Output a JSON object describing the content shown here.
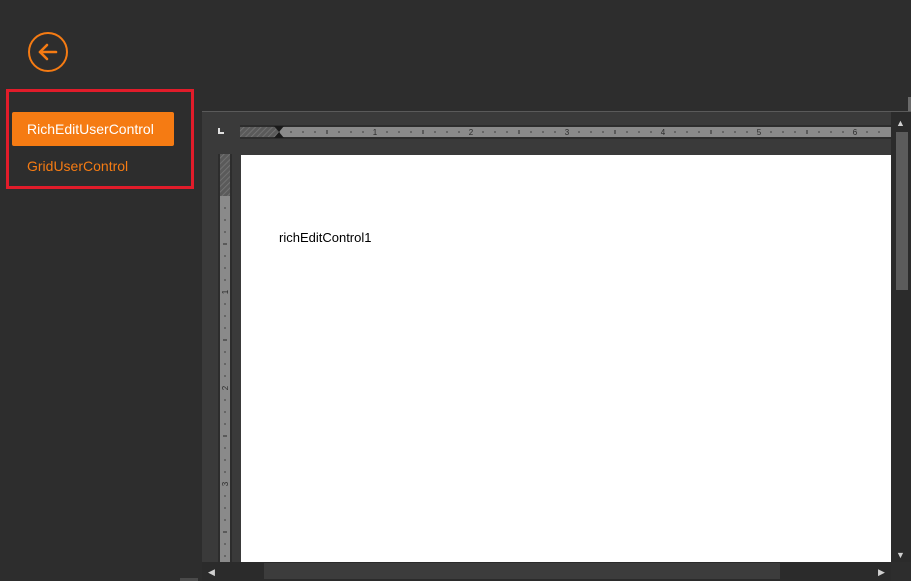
{
  "header": {
    "back_icon": "arrow-left-circle-icon"
  },
  "nav": {
    "items": [
      {
        "label": "RichEditUserControl",
        "active": true
      },
      {
        "label": "GridUserControl",
        "active": false
      }
    ]
  },
  "ruler": {
    "horizontal_numbers": [
      "1",
      "2",
      "3",
      "4",
      "5",
      "6"
    ],
    "vertical_numbers": [
      "1",
      "2",
      "3"
    ]
  },
  "editor": {
    "content": "richEditControl1"
  },
  "colors": {
    "accent": "#f57b13",
    "highlight_frame": "#e11c2a",
    "background": "#2d2d2d"
  }
}
